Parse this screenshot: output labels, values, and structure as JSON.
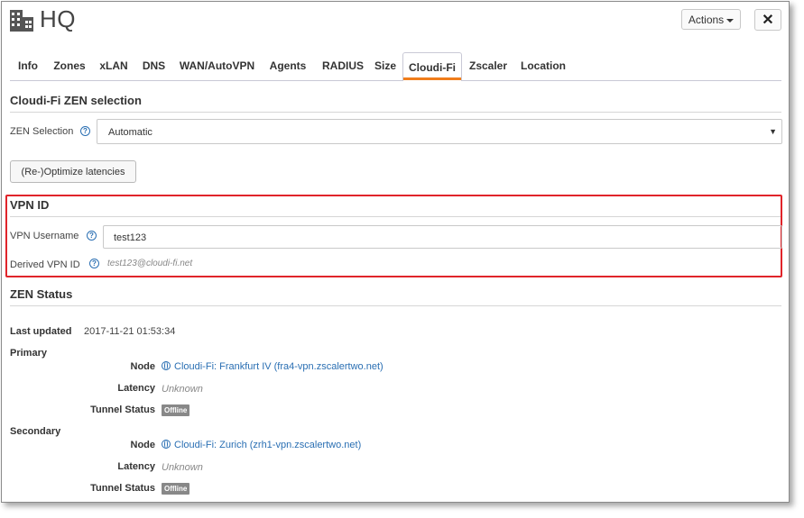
{
  "header": {
    "title": "HQ",
    "actions_label": "Actions",
    "close_label": "✕"
  },
  "tabs": [
    {
      "label": "Info",
      "active": false
    },
    {
      "label": "Zones",
      "active": false
    },
    {
      "label": "xLAN",
      "active": false
    },
    {
      "label": "DNS",
      "active": false
    },
    {
      "label": "WAN/AutoVPN",
      "active": false
    },
    {
      "label": "Agents",
      "active": false
    },
    {
      "label": "RADIUS",
      "active": false
    },
    {
      "label": "Size",
      "active": false
    },
    {
      "label": "Cloudi-Fi",
      "active": true
    },
    {
      "label": "Zscaler",
      "active": false
    },
    {
      "label": "Location",
      "active": false
    }
  ],
  "zen_selection": {
    "section_title": "Cloudi-Fi ZEN selection",
    "label": "ZEN Selection",
    "help": "?",
    "selected": "Automatic",
    "optimize_button": "(Re-)Optimize latencies"
  },
  "vpn_id": {
    "section_title": "VPN ID",
    "username_label": "VPN Username",
    "username_value": "test123",
    "derived_label": "Derived VPN ID",
    "derived_value": "test123@cloudi-fi.net",
    "help": "?"
  },
  "zen_status": {
    "section_title": "ZEN Status",
    "last_updated_label": "Last updated",
    "last_updated_value": "2017-11-21 01:53:34",
    "primary": {
      "heading": "Primary",
      "node_label": "Node",
      "node_value": "Cloudi-Fi: Frankfurt IV (fra4-vpn.zscalertwo.net)",
      "latency_label": "Latency",
      "latency_value": "Unknown",
      "tunnel_label": "Tunnel Status",
      "tunnel_value": "Offline"
    },
    "secondary": {
      "heading": "Secondary",
      "node_label": "Node",
      "node_value": "Cloudi-Fi: Zurich (zrh1-vpn.zscalertwo.net)",
      "latency_label": "Latency",
      "latency_value": "Unknown",
      "tunnel_label": "Tunnel Status",
      "tunnel_value": "Offline"
    }
  },
  "colors": {
    "accent": "#f07d1b",
    "highlight_box": "#e0242a",
    "link": "#2a6fb3",
    "badge": "#888888"
  }
}
